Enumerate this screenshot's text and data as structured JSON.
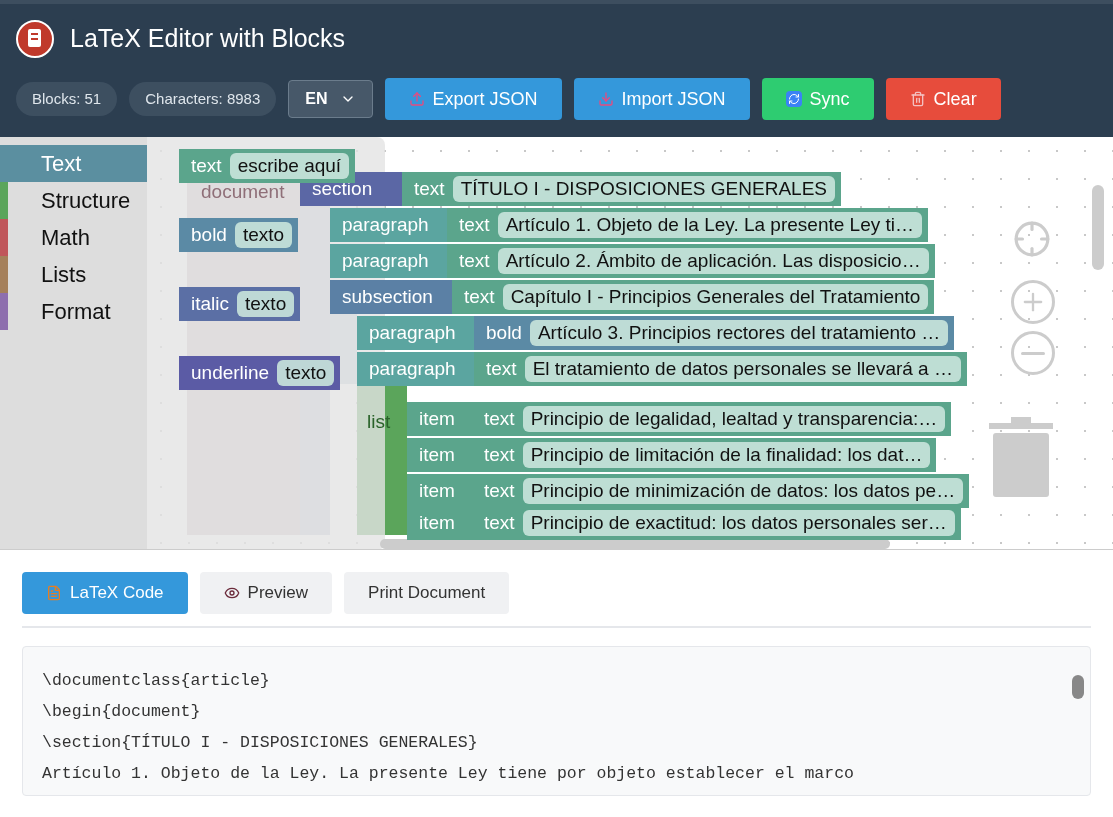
{
  "header": {
    "title": "LaTeX Editor with Blocks",
    "stats": [
      "Blocks: 51",
      "Characters: 8983"
    ],
    "language": "EN",
    "buttons": [
      {
        "label": "Export JSON",
        "kind": "export"
      },
      {
        "label": "Import JSON",
        "kind": "import"
      },
      {
        "label": "Sync",
        "kind": "sync"
      },
      {
        "label": "Clear",
        "kind": "clear"
      }
    ]
  },
  "categories": [
    {
      "label": "Text",
      "color": "#5b8fa0",
      "selected": true
    },
    {
      "label": "Structure",
      "color": "#5ba55b",
      "selected": false
    },
    {
      "label": "Math",
      "color": "#c0565b",
      "selected": false
    },
    {
      "label": "Lists",
      "color": "#a5805b",
      "selected": false
    },
    {
      "label": "Format",
      "color": "#8e6fae",
      "selected": false
    }
  ],
  "flyout": [
    {
      "kind": "text",
      "label": "text",
      "value": "escribe aquí"
    },
    {
      "kind": "bold",
      "label": "bold",
      "value": "texto"
    },
    {
      "kind": "italic",
      "label": "italic",
      "value": "texto"
    },
    {
      "kind": "underline",
      "label": "underline",
      "value": "texto"
    }
  ],
  "workspace": {
    "containers": [
      {
        "kind": "document",
        "label": "document"
      },
      {
        "kind": "list",
        "label": "list"
      }
    ],
    "rows": [
      {
        "parent": {
          "kind": "section",
          "label": "section"
        },
        "kind": "text",
        "label": "text",
        "value": "TÍTULO I - DISPOSICIONES GENERALES"
      },
      {
        "parent": {
          "kind": "paragraph",
          "label": "paragraph"
        },
        "kind": "text",
        "label": "text",
        "value": "Artículo 1. Objeto de la Ley. La presente Ley ti…"
      },
      {
        "parent": {
          "kind": "paragraph",
          "label": "paragraph"
        },
        "kind": "text",
        "label": "text",
        "value": "Artículo 2. Ámbito de aplicación. Las disposicio…"
      },
      {
        "parent": {
          "kind": "subsection",
          "label": "subsection"
        },
        "kind": "text",
        "label": "text",
        "value": "Capítulo I - Principios Generales del Tratamiento"
      },
      {
        "parent": {
          "kind": "paragraph",
          "label": "paragraph"
        },
        "kind": "bold",
        "label": "bold",
        "value": "Artículo 3. Principios rectores del tratamiento …"
      },
      {
        "parent": {
          "kind": "paragraph",
          "label": "paragraph"
        },
        "kind": "text",
        "label": "text",
        "value": "El tratamiento de datos personales se llevará a …"
      },
      {
        "parent": {
          "kind": "item",
          "label": "item"
        },
        "kind": "text",
        "label": "text",
        "value": "Principio de legalidad, lealtad y transparencia:…"
      },
      {
        "parent": {
          "kind": "item",
          "label": "item"
        },
        "kind": "text",
        "label": "text",
        "value": "Principio de limitación de la finalidad: los dat…"
      },
      {
        "parent": {
          "kind": "item",
          "label": "item"
        },
        "kind": "text",
        "label": "text",
        "value": "Principio de minimización de datos: los datos pe…"
      },
      {
        "parent": {
          "kind": "item",
          "label": "item"
        },
        "kind": "text",
        "label": "text",
        "value": "Principio de exactitud: los datos personales ser…"
      }
    ]
  },
  "output": {
    "tabs": [
      {
        "label": "LaTeX Code",
        "kind": "code",
        "selected": true
      },
      {
        "label": "Preview",
        "kind": "preview",
        "selected": false
      }
    ],
    "print_button": "Print Document",
    "code_lines": [
      "\\documentclass{article}",
      "\\begin{document}",
      "\\section{TÍTULO I - DISPOSICIONES GENERALES}",
      "Artículo 1. Objeto de la Ley. La presente Ley tiene por objeto establecer el marco"
    ]
  }
}
